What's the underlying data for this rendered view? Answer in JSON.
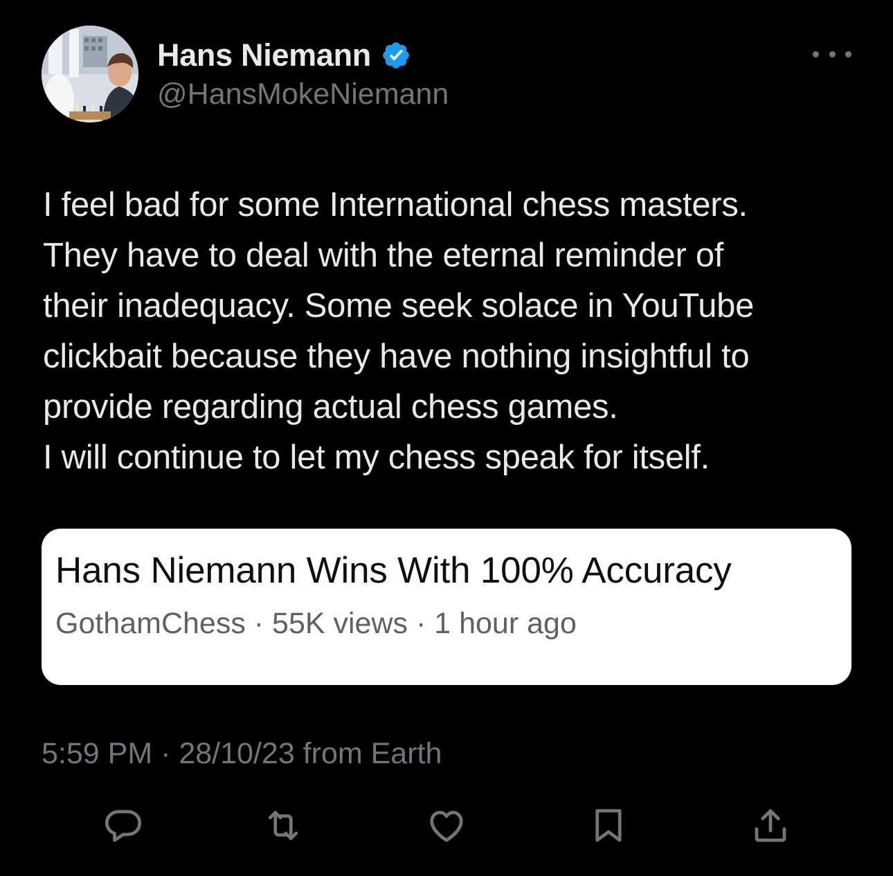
{
  "colors": {
    "background": "#000000",
    "primary_text": "#e7e9ea",
    "secondary_text": "#71767b",
    "verified_badge": "#1d9bf0",
    "card_background": "#ffffff",
    "card_title": "#0f0f0f",
    "card_meta": "#606060"
  },
  "author": {
    "display_name": "Hans Niemann",
    "handle": "@HansMokeNiemann",
    "verified_icon": "verified-badge-icon",
    "avatar_icon": "profile-photo"
  },
  "more_icon": "more-options-icon",
  "tweet": {
    "lines": [
      "I feel bad for some International chess masters.",
      "They have to deal with the eternal reminder of",
      "their inadequacy. Some seek solace in YouTube",
      "clickbait because they have nothing insightful to",
      "provide regarding actual chess games.",
      "I will continue to let my chess speak for itself."
    ]
  },
  "card": {
    "title": "Hans Niemann Wins With 100% Accuracy",
    "meta": "GothamChess · 55K views · 1 hour ago"
  },
  "timestamp": "5:59 PM · 28/10/23 from Earth",
  "actions": [
    {
      "icon": "reply-icon"
    },
    {
      "icon": "retweet-icon"
    },
    {
      "icon": "like-icon"
    },
    {
      "icon": "bookmark-icon"
    },
    {
      "icon": "share-icon"
    }
  ]
}
